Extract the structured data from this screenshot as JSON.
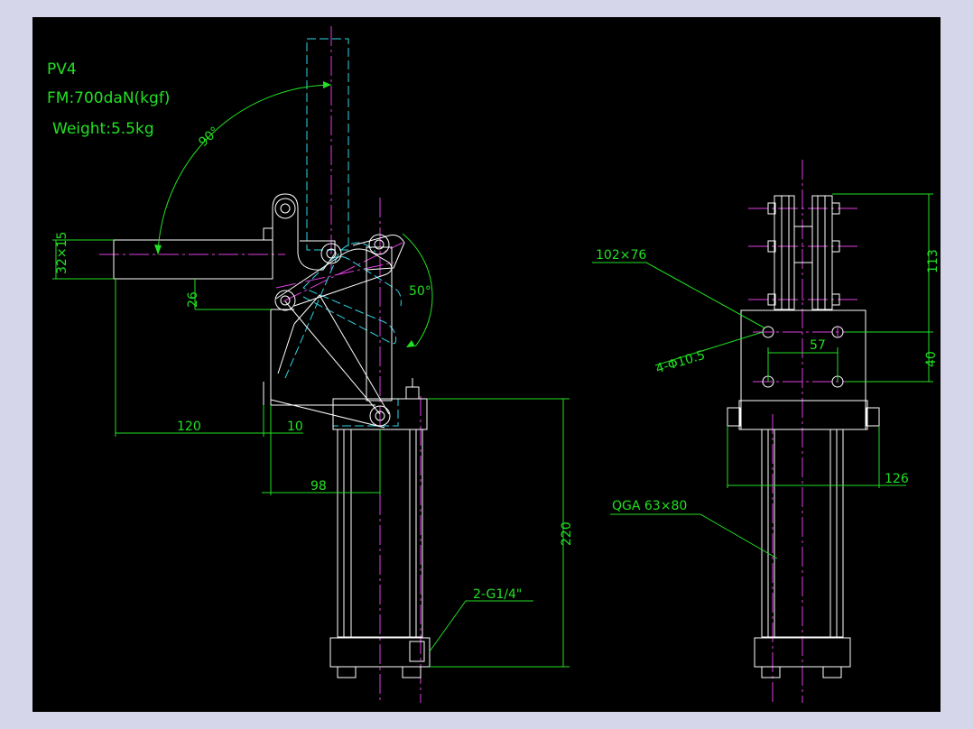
{
  "notes": {
    "model": "PV4",
    "force": "FM:700daN(kgf)",
    "weight": "Weight:5.5kg"
  },
  "dims": {
    "arm_section": "32×15",
    "d26": "26",
    "d120": "120",
    "d10": "10",
    "d98": "98",
    "d220": "220",
    "port": "2-G1/4\"",
    "angle90": "90°",
    "angle50": "50°",
    "plate": "102×76",
    "holes": "4-Φ10.5",
    "d57": "57",
    "d113": "113",
    "d40": "40",
    "d126": "126",
    "cylinder": "QGA 63×80"
  },
  "colors": {
    "background": "#000000",
    "frame": "#d6d6ea",
    "outline": "#ffffff",
    "dimension": "#22e022",
    "centerline": "#e040e0",
    "phantom": "#2fd4e6"
  }
}
